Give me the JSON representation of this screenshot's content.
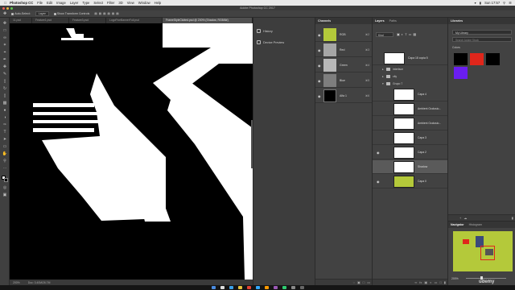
{
  "menubar": {
    "app_name": "Photoshop CC",
    "items": [
      "File",
      "Edit",
      "Image",
      "Layer",
      "Type",
      "Select",
      "Filter",
      "3D",
      "View",
      "Window",
      "Help"
    ],
    "clock": "Sun 17:57"
  },
  "window": {
    "title": "Adobe Photoshop CC 2017"
  },
  "options": {
    "auto_select_label": "Auto-Select:",
    "auto_select_value": "Layer",
    "transform_label": "Show Transform Controls"
  },
  "doc_tabs": [
    {
      "label": "11.psd"
    },
    {
      "label": "Feature1.psd"
    },
    {
      "label": "Feature3.psd"
    },
    {
      "label": "LogoFiveBannerFull.psd"
    },
    {
      "label": "FrameStyleClutted.psd @ 200% (Shadow, RGB/8#)"
    }
  ],
  "status": {
    "zoom": "200%",
    "doc": "Doc: 3.40M/26.7M"
  },
  "collapsed_panels": [
    {
      "label": "History",
      "icon": "history-icon"
    },
    {
      "label": "Device Preview",
      "icon": "device-preview-icon"
    }
  ],
  "channels": {
    "title": "Channels",
    "rows": [
      {
        "name": "RGB",
        "key": "⌘2"
      },
      {
        "name": "Red",
        "key": "⌘3"
      },
      {
        "name": "Green",
        "key": "⌘4"
      },
      {
        "name": "Blue",
        "key": "⌘5"
      },
      {
        "name": "Alfa 1",
        "key": "⌘6"
      }
    ]
  },
  "layers": {
    "tabs": [
      "Layers",
      "Paths"
    ],
    "kind_label": "Kind",
    "rows": [
      {
        "type": "layer",
        "name": "Capa 18 copia 5"
      },
      {
        "type": "group",
        "name": "interface"
      },
      {
        "type": "group",
        "name": "city"
      },
      {
        "type": "group",
        "name": "Grupo 7"
      },
      {
        "type": "layer",
        "name": "Capa 4"
      },
      {
        "type": "layer",
        "name": "Ambient Occlusio..."
      },
      {
        "type": "layer",
        "name": "Ambient Occlusio..."
      },
      {
        "type": "layer",
        "name": "Capa 3"
      },
      {
        "type": "layer",
        "name": "Capa 2"
      },
      {
        "type": "layer",
        "name": "Shadow"
      },
      {
        "type": "layer",
        "name": "Capa 0"
      }
    ]
  },
  "libraries": {
    "title": "Libraries",
    "library_name": "My Library",
    "search_placeholder": "Search Adobe Stock",
    "section_label": "Colors",
    "colors": [
      "#000000",
      "#e0261b",
      "#000000",
      "#6a1ef0"
    ]
  },
  "navigator": {
    "tabs": [
      "Navigator",
      "Histogram"
    ],
    "zoom": "200%"
  },
  "watermark": "udemy"
}
